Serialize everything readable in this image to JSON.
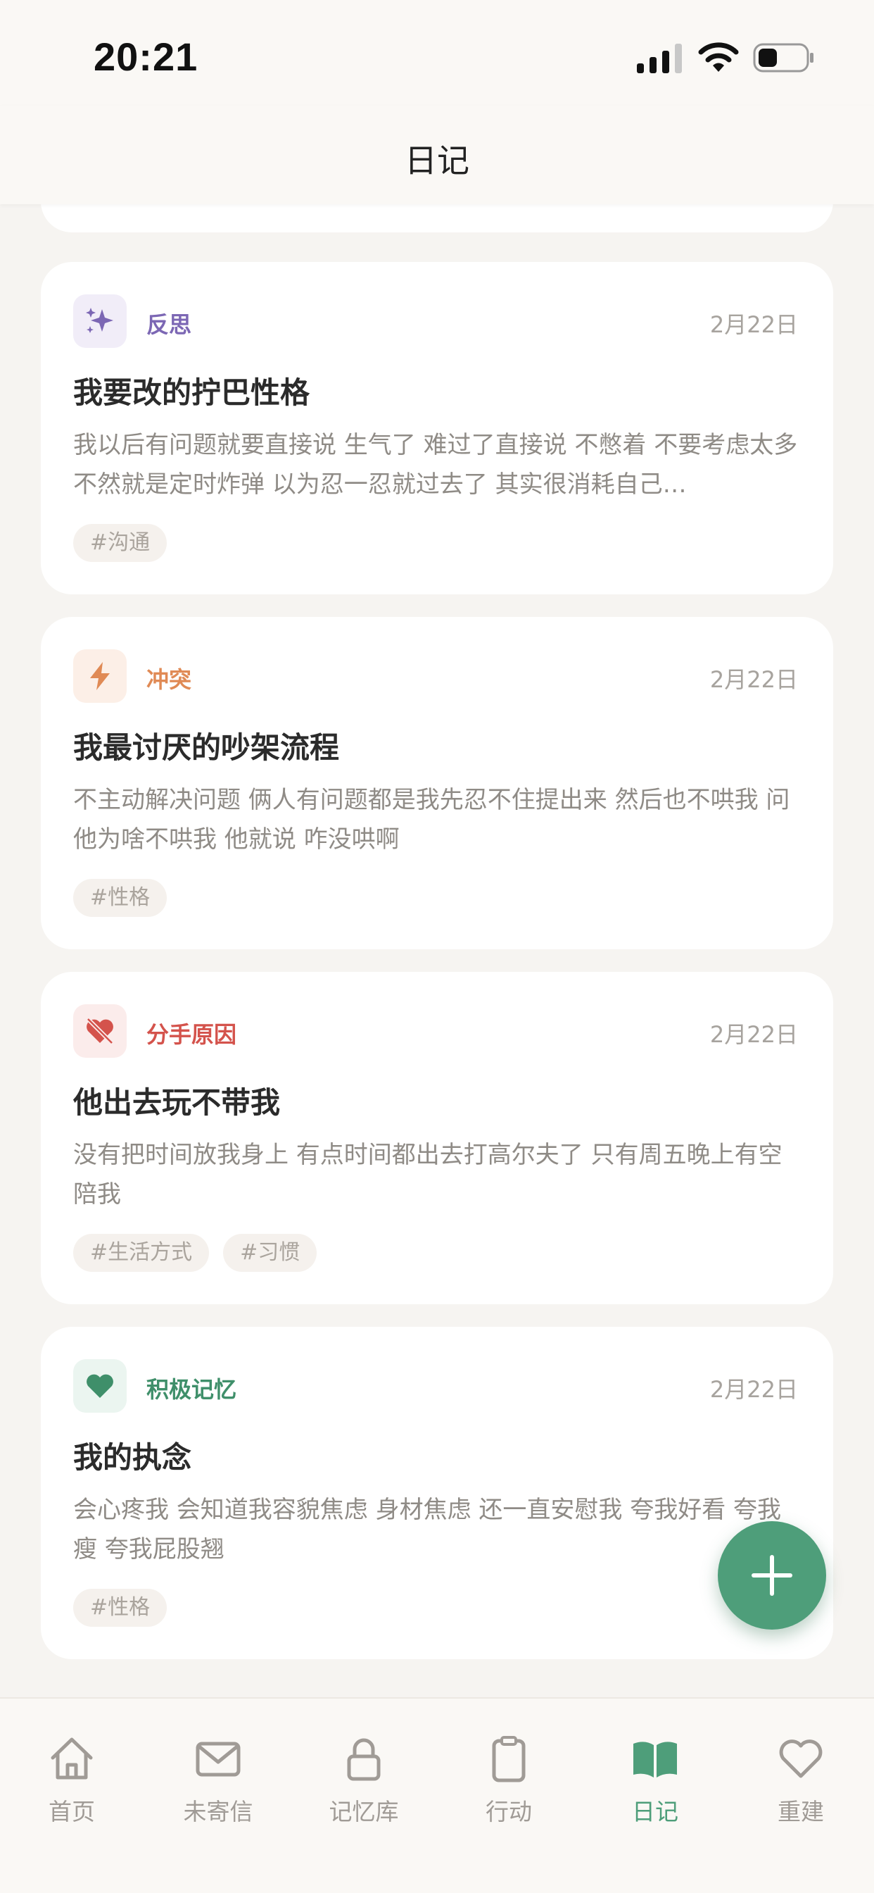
{
  "status_bar": {
    "time": "20:21"
  },
  "header": {
    "title": "日记"
  },
  "entries": [
    {
      "category": "反思",
      "category_color": "#7c67b4",
      "icon_bg": "#f1edf8",
      "icon": "sparkle-icon",
      "date": "2月22日",
      "title": "我要改的拧巴性格",
      "body": "我以后有问题就要直接说 生气了 难过了直接说 不憋着 不要考虑太多 不然就是定时炸弹 以为忍一忍就过去了 其实很消耗自己…",
      "tags": [
        "#沟通"
      ]
    },
    {
      "category": "冲突",
      "category_color": "#e08a55",
      "icon_bg": "#fcefe7",
      "icon": "lightning-icon",
      "date": "2月22日",
      "title": "我最讨厌的吵架流程",
      "body": "不主动解决问题 俩人有问题都是我先忍不住提出来 然后也不哄我 问他为啥不哄我 他就说 咋没哄啊",
      "tags": [
        "#性格"
      ]
    },
    {
      "category": "分手原因",
      "category_color": "#d4534c",
      "icon_bg": "#fbeceb",
      "icon": "broken-heart-icon",
      "date": "2月22日",
      "title": "他出去玩不带我",
      "body": "没有把时间放我身上 有点时间都出去打高尔夫了 只有周五晚上有空陪我",
      "tags": [
        "#生活方式",
        "#习惯"
      ]
    },
    {
      "category": "积极记忆",
      "category_color": "#3f8f6a",
      "icon_bg": "#ebf5f0",
      "icon": "heart-icon",
      "date": "2月22日",
      "title": "我的执念",
      "body": "会心疼我 会知道我容貌焦虑 身材焦虑 还一直安慰我 夸我好看 夸我瘦 夸我屁股翘",
      "tags": [
        "#性格"
      ]
    }
  ],
  "tabs": [
    {
      "label": "首页",
      "icon": "home-icon",
      "active": false
    },
    {
      "label": "未寄信",
      "icon": "mail-icon",
      "active": false
    },
    {
      "label": "记忆库",
      "icon": "lock-icon",
      "active": false
    },
    {
      "label": "行动",
      "icon": "clipboard-icon",
      "active": false
    },
    {
      "label": "日记",
      "icon": "book-icon",
      "active": true
    },
    {
      "label": "重建",
      "icon": "heart-outline-icon",
      "active": false
    }
  ],
  "colors": {
    "accent": "#4e9e7a",
    "inactive": "#a09b96"
  }
}
